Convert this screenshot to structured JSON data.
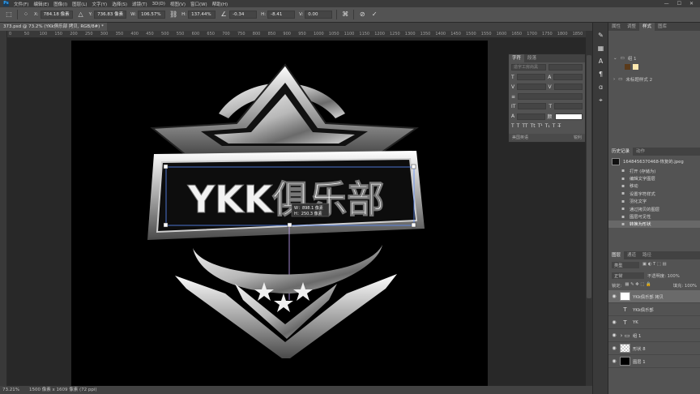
{
  "menubar": {
    "logo": "Ps",
    "items": [
      "文件(F)",
      "编辑(E)",
      "图像(I)",
      "图层(L)",
      "文字(Y)",
      "选择(S)",
      "滤镜(T)",
      "3D(D)",
      "视图(V)",
      "窗口(W)",
      "帮助(H)"
    ],
    "window_controls": [
      "—",
      "☐",
      "✕"
    ]
  },
  "options": {
    "x_label": "X:",
    "x_value": "784.18 像素",
    "y_label": "Y:",
    "y_value": "736.83 像素",
    "w_label": "W:",
    "w_value": "106.57%",
    "h_label": "H:",
    "h_value": "137.44%",
    "angle_value": "-0.34",
    "hskew_label": "H:",
    "hskew_value": "-8.41",
    "vskew_label": "V:",
    "vskew_value": "0.00"
  },
  "document": {
    "tab_title": "373.psd @ 73.2% (YKk俱乐部 拷贝, RGB/8#) *",
    "ruler_marks": [
      "0",
      "50",
      "100",
      "150",
      "200",
      "250",
      "300",
      "350",
      "400",
      "450",
      "500",
      "550",
      "600",
      "650",
      "700",
      "750",
      "800",
      "850",
      "900",
      "950",
      "1000",
      "1050",
      "1100",
      "1150",
      "1200",
      "1250",
      "1300",
      "1350",
      "1400",
      "1450",
      "1500",
      "1550",
      "1600",
      "1650",
      "1700",
      "1750",
      "1800",
      "1850"
    ]
  },
  "artwork": {
    "logo_text": "YKK俱乐部",
    "transform_w": "W：898.1 像素",
    "transform_h": "H：250.3 像素"
  },
  "status": {
    "zoom": "73.21%",
    "doc_info": "1500 像素 x 1609 像素 (72 ppi)"
  },
  "char_panel": {
    "tabs": [
      "字符",
      "段落"
    ],
    "font_placeholder": "造字工房尚黑",
    "footer_left": "美国英语",
    "footer_right": "锐利",
    "type_buttons": [
      "T",
      "T",
      "TT",
      "Tt",
      "T¹",
      "T₁",
      "T",
      "T̶"
    ]
  },
  "right_panels": {
    "top_tabs": [
      "属性",
      "调整",
      "样式",
      "图库"
    ],
    "top_active": "样式",
    "style_group_1": "组 1",
    "style_group_2": "未标题样式 2",
    "history_tabs": [
      "历史记录",
      "动作"
    ],
    "history_snapshot": "1648456370468-恢复的.jpeg",
    "history_items": [
      "打开 (存储为)",
      "编辑文字图层",
      "移动",
      "设置字符样式",
      "羽化文字",
      "通过拷贝的图层",
      "图层可见性",
      "转换为形状"
    ],
    "history_selected": 7,
    "layers_tabs": [
      "图层",
      "通道",
      "路径"
    ],
    "kind_label": "类型",
    "blend_mode": "正常",
    "opacity_label": "不透明度: 100%",
    "fill_label": "填充: 100%",
    "lock_label": "锁定:",
    "layers": [
      {
        "name": "YKk俱乐部 拷贝",
        "kind": "smart",
        "visible": true,
        "selected": true
      },
      {
        "name": "YKk俱乐部",
        "kind": "text",
        "visible": false,
        "selected": false
      },
      {
        "name": "YK",
        "kind": "text",
        "visible": true,
        "selected": false
      },
      {
        "name": "组 1",
        "kind": "group",
        "visible": true,
        "selected": false
      },
      {
        "name": "形状 8",
        "kind": "shape",
        "visible": true,
        "selected": false
      },
      {
        "name": "图层 1",
        "kind": "fill",
        "visible": true,
        "selected": false
      }
    ]
  }
}
